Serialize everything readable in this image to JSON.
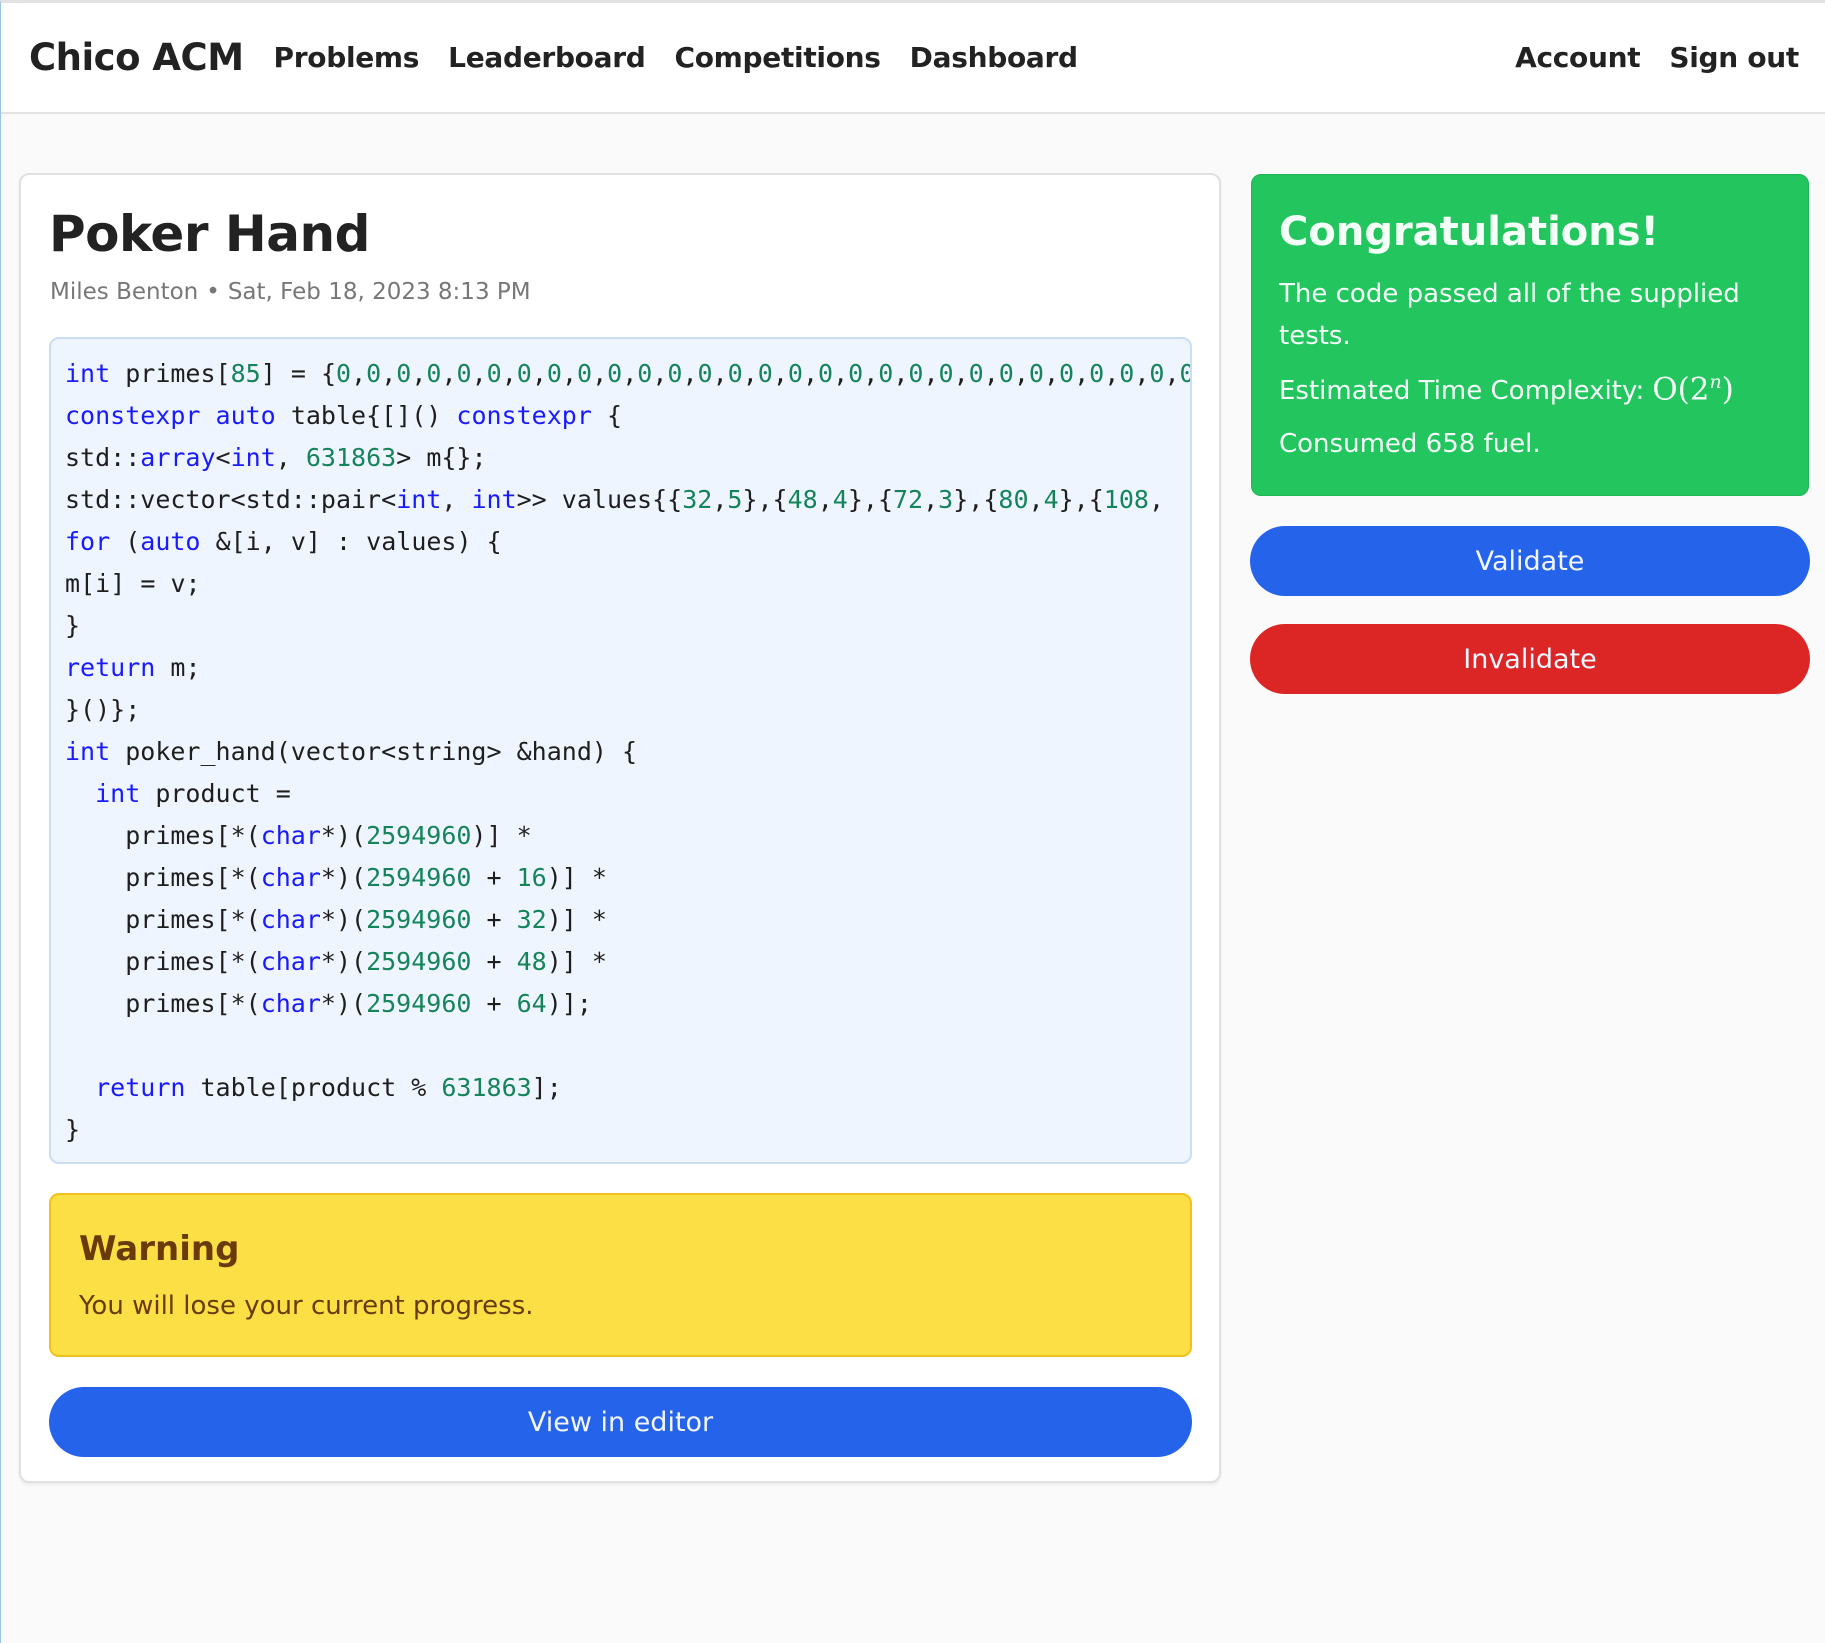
{
  "navbar": {
    "brand": "Chico ACM",
    "links": [
      "Problems",
      "Leaderboard",
      "Competitions",
      "Dashboard"
    ],
    "right_links": [
      "Account",
      "Sign out"
    ]
  },
  "submission": {
    "title": "Poker Hand",
    "author": "Miles Benton",
    "separator": "•",
    "timestamp": "Sat, Feb 18, 2023 8:13 PM",
    "language": "cpp",
    "code_lines": [
      "int primes[85] = {0,0,0,0,0,0,0,0,0,0,0,0,0,0,0,0,0,0,0,0,0,0,0,0,0,0,0,0,0,0",
      "constexpr auto table{[]() constexpr {",
      "std::array<int, 631863> m{};",
      "std::vector<std::pair<int, int>> values{{32,5},{48,4},{72,3},{80,4},{108,",
      "for (auto &[i, v] : values) {",
      "m[i] = v;",
      "}",
      "return m;",
      "}()};",
      "int poker_hand(vector<string> &hand) {",
      "  int product =",
      "    primes[*(char*)(2594960)] *",
      "    primes[*(char*)(2594960 + 16)] *",
      "    primes[*(char*)(2594960 + 32)] *",
      "    primes[*(char*)(2594960 + 48)] *",
      "    primes[*(char*)(2594960 + 64)];",
      "",
      "  return table[product % 631863];",
      "}"
    ]
  },
  "warning": {
    "title": "Warning",
    "message": "You will lose your current progress."
  },
  "buttons": {
    "view_in_editor": "View in editor",
    "validate": "Validate",
    "invalidate": "Invalidate"
  },
  "result": {
    "title": "Congratulations!",
    "message": "The code passed all of the supplied tests.",
    "complexity_label": "Estimated Time Complexity:",
    "complexity_base": "O(2",
    "complexity_exp": "n",
    "complexity_close": ")",
    "fuel_text": "Consumed 658 fuel.",
    "fuel": 658
  },
  "colors": {
    "primary": "#2563eb",
    "danger": "#dc2626",
    "success": "#22c55e",
    "warning": "#fcdf45",
    "code_keyword": "#1a1aff",
    "code_number": "#16845a"
  }
}
